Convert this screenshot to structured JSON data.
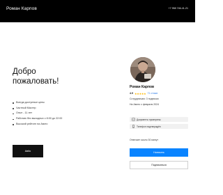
{
  "header": {
    "brand": "Роман Карпов",
    "phone": "+7 958 746-41-21"
  },
  "hero": {
    "title_line1": "Добро",
    "title_line2": "пожаловать!",
    "benefits": [
      "Всегда доступные цены",
      "Частный Мастер",
      "Опыт - 11 лет",
      "Работаю без выходных с 8:00 до 22:00",
      "Высокий рейтинг на Авито"
    ],
    "cta_label": "Авito"
  },
  "profile": {
    "name": "Роман Карпов",
    "rating": "4.9",
    "stars": "★★★★★",
    "reviews": "71 отзыв",
    "meta1": "Сотрудничаю: 3 подписки",
    "meta2": "На Авито с февраля 2024",
    "badge_docs": "Документы проверены",
    "badge_phone": "Телефон подтверждён",
    "response": "Отвечает около 30 минут",
    "write_label": "Написать",
    "subscribe_label": "Подписаться"
  },
  "colors": {
    "accent": "#0a84ff",
    "stars": "#ffb800",
    "reviews_link": "#2e7ce6"
  }
}
